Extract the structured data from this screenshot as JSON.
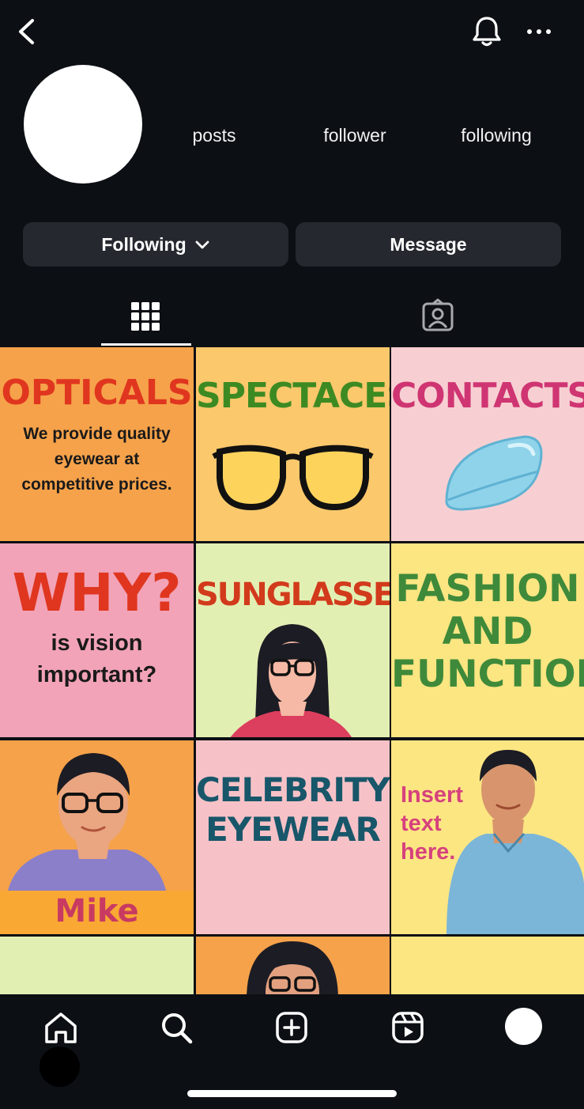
{
  "profile": {
    "stats": {
      "posts_label": "posts",
      "follower_label": "follower",
      "following_label": "following"
    }
  },
  "actions": {
    "following_label": "Following",
    "message_label": "Message"
  },
  "tabs": [
    {
      "name": "grid",
      "icon": "grid-icon",
      "active": true
    },
    {
      "name": "tagged",
      "icon": "tagged-icon",
      "active": false
    }
  ],
  "posts": {
    "opticals": {
      "title": "OPTICALS",
      "line1": "We provide quality",
      "line2": "eyewear at",
      "line3": "competitive prices."
    },
    "spectaces": {
      "title": "SPECTACES"
    },
    "contacts": {
      "title": "CONTACTS"
    },
    "why": {
      "title": "WHY?",
      "line1": "is vision",
      "line2": "important?"
    },
    "sunglasses": {
      "title": "SUNGLASSES"
    },
    "fashion": {
      "line1": "FASHION",
      "line2": "AND",
      "line3": "FUNCTION"
    },
    "mike": {
      "name": "Mike"
    },
    "celebrity": {
      "line1": "CELEBRITY",
      "line2": "EYEWEAR"
    },
    "insert": {
      "line1": "Insert",
      "line2": "text",
      "line3": "here."
    }
  },
  "colors": {
    "background": "#0c0f14",
    "button_bg": "#25282e",
    "orange": "#f6a24a",
    "light_orange": "#fbc86c",
    "pink_light": "#f7cfd2",
    "pink": "#f2a3b7",
    "lime": "#e2efb3",
    "yellow": "#fce682"
  },
  "nav": [
    "home-icon",
    "search-icon",
    "create-icon",
    "reels-icon",
    "profile-avatar"
  ]
}
